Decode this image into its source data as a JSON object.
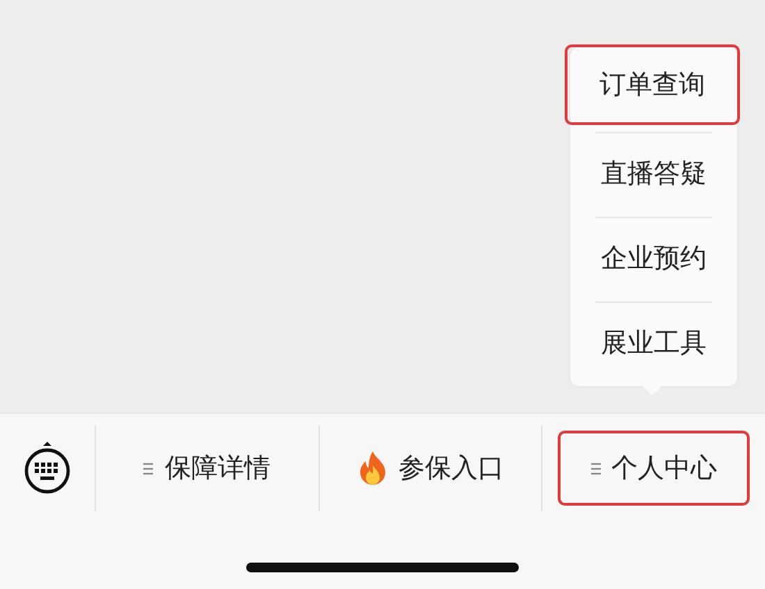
{
  "popup_menu": {
    "items": [
      {
        "label": "订单查询",
        "highlighted": true
      },
      {
        "label": "直播答疑",
        "highlighted": false
      },
      {
        "label": "企业预约",
        "highlighted": false
      },
      {
        "label": "展业工具",
        "highlighted": false
      }
    ]
  },
  "bottom_menu": {
    "tabs": [
      {
        "label": "保障详情",
        "kind": "menu",
        "highlighted": false
      },
      {
        "label": "参保入口",
        "kind": "fire",
        "highlighted": false
      },
      {
        "label": "个人中心",
        "kind": "menu",
        "highlighted": true
      }
    ]
  }
}
